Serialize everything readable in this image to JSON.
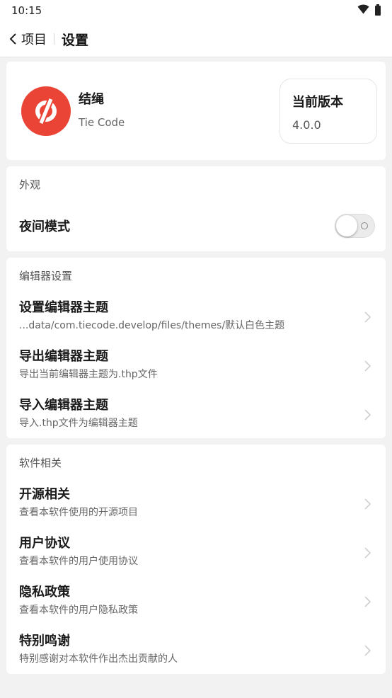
{
  "status_bar": {
    "time": "10:15",
    "icons": [
      "wifi-icon",
      "battery-icon"
    ]
  },
  "app_bar": {
    "back_label": "项目",
    "title": "设置"
  },
  "app_info": {
    "name": "结绳",
    "subtitle": "Tie Code",
    "logo_icon": "tiecode-logo-icon",
    "version_label": "当前版本",
    "version_value": "4.0.0",
    "brand_color": "#e94435"
  },
  "appearance": {
    "header": "外观",
    "night_mode_label": "夜间模式",
    "night_mode_on": false
  },
  "editor_settings": {
    "header": "编辑器设置",
    "items": [
      {
        "title": "设置编辑器主题",
        "subtitle": "...data/com.tiecode.develop/files/themes/默认白色主题"
      },
      {
        "title": "导出编辑器主题",
        "subtitle": "导出当前编辑器主题为.thp文件"
      },
      {
        "title": "导入编辑器主题",
        "subtitle": "导入.thp文件为编辑器主题"
      }
    ]
  },
  "software": {
    "header": "软件相关",
    "items": [
      {
        "title": "开源相关",
        "subtitle": "查看本软件使用的开源项目"
      },
      {
        "title": "用户协议",
        "subtitle": "查看本软件的用户使用协议"
      },
      {
        "title": "隐私政策",
        "subtitle": "查看本软件的用户隐私政策"
      },
      {
        "title": "特别鸣谢",
        "subtitle": "特别感谢对本软件作出杰出贡献的人"
      }
    ]
  }
}
